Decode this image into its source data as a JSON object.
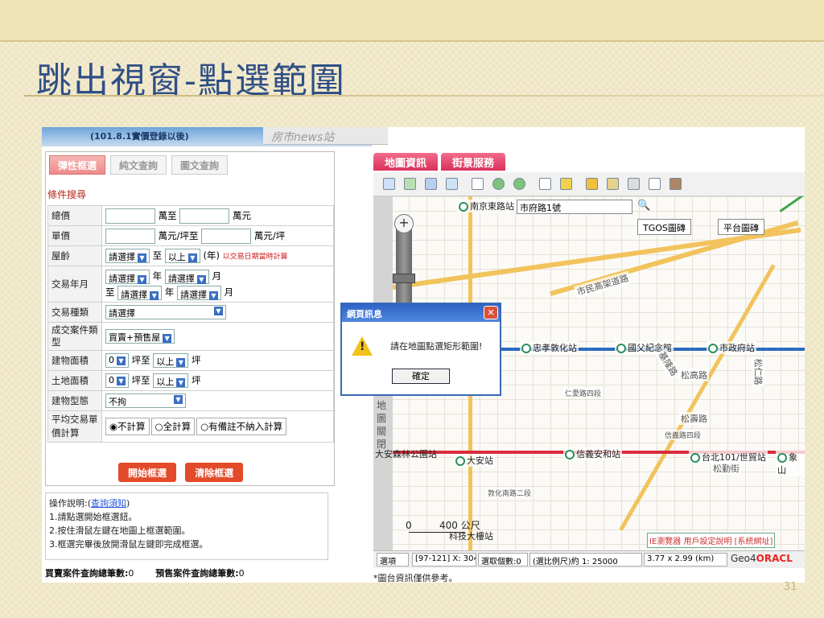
{
  "slide": {
    "title": "跳出視窗-點選範圍",
    "page_number": "31",
    "accent": "#2f4f86"
  },
  "app": {
    "header_text": "(101.8.1實價登錄以後)",
    "news_tab": "房市news站",
    "search_tabs": [
      "彈性框選",
      "純文查詢",
      "圖文查詢"
    ],
    "section_label": "條件搜尋",
    "fields": {
      "total_price": {
        "label": "總價",
        "unit1": "萬至",
        "unit2": "萬元"
      },
      "unit_price": {
        "label": "單價",
        "unit1": "萬元/坪至",
        "unit2": "萬元/坪"
      },
      "house_age": {
        "label": "屋齡",
        "select1": "請選擇",
        "to": "至",
        "select2": "以上",
        "unit": "(年)",
        "note": "以交易日期當時計算"
      },
      "trade_ym": {
        "label": "交易年月",
        "sel_year": "請選擇",
        "year": "年",
        "sel_month": "請選擇",
        "month": "月",
        "to": "至"
      },
      "trade_type": {
        "label": "交易種類",
        "select": "請選擇"
      },
      "case_type": {
        "label": "成交案件類型",
        "select": "買賣+預售屋"
      },
      "building_area": {
        "label": "建物面積",
        "select1": "0",
        "unit1": "坪至",
        "select2": "以上",
        "unit2": "坪"
      },
      "land_area": {
        "label": "土地面積",
        "select1": "0",
        "unit1": "坪至",
        "select2": "以上",
        "unit2": "坪"
      },
      "building_type": {
        "label": "建物型態",
        "select": "不拘"
      },
      "avg_price": {
        "label": "平均交易單價計算",
        "options": [
          "不計算",
          "全計算",
          "有備註不納入計算"
        ]
      }
    },
    "buttons": {
      "start": "開始框選",
      "clear": "清除框選"
    },
    "instructions": {
      "title": "操作說明:(",
      "link": "查詢須知",
      "close": ")",
      "steps": [
        "1.請點選開始框選鈕。",
        "2.按住滑鼠左鍵在地圖上框選範圍。",
        "3.框選完畢後放開滑鼠左鍵即完成框選。"
      ]
    },
    "footer": {
      "buy_label": "買賣案件查詢總筆數:",
      "buy_count": "0",
      "presale_label": "預售案件查詢總筆數:",
      "presale_count": "0"
    }
  },
  "map": {
    "tabs": [
      "地圖資訊",
      "街景服務"
    ],
    "toolbar_icons": [
      "layers-icon",
      "refresh-icon",
      "globe-icon",
      "print-map-icon",
      "zoom-box-icon",
      "zoom-in-icon",
      "zoom-out-icon",
      "pointer-icon",
      "pan-icon",
      "measure-icon",
      "ruler-icon",
      "print-icon",
      "camera-icon",
      "trash-icon"
    ],
    "address": "市府路1號",
    "map_types": [
      "TGOS圖磚",
      "平台圖磚"
    ],
    "side_label": "地圖關閉",
    "stations": [
      "南京東路站",
      "忠孝敦化站",
      "國父紀念館",
      "市政府站",
      "大安站",
      "信義安和站",
      "台北101/世貿站",
      "象山",
      "大安森林公園站",
      "科技大樓站"
    ],
    "roads": [
      "市民高架道路",
      "基隆路",
      "松高路",
      "松壽路",
      "松勤街",
      "松仁路",
      "仁愛路四段",
      "敦化南路二段",
      "信義路四段"
    ],
    "scale": "400 公尺",
    "scale_zero": "0",
    "links": "IE瀏覽器 用戶設定說明 [系統網址]",
    "status": {
      "btn": "選項",
      "coords": "[97-121] X: 3046",
      "select_count": "選取個數:0",
      "scale": "(選比例尺)約 1: 25000",
      "extent": "3.77 x 2.99 (km)",
      "brand1": "Geo4",
      "brand2": "ORACL"
    },
    "disclaimer": "*圖台資訊僅供參考。",
    "dialog": {
      "title": "網頁訊息",
      "message": "請在地圖點選矩形範圍!",
      "ok": "確定",
      "close": "✕"
    }
  }
}
